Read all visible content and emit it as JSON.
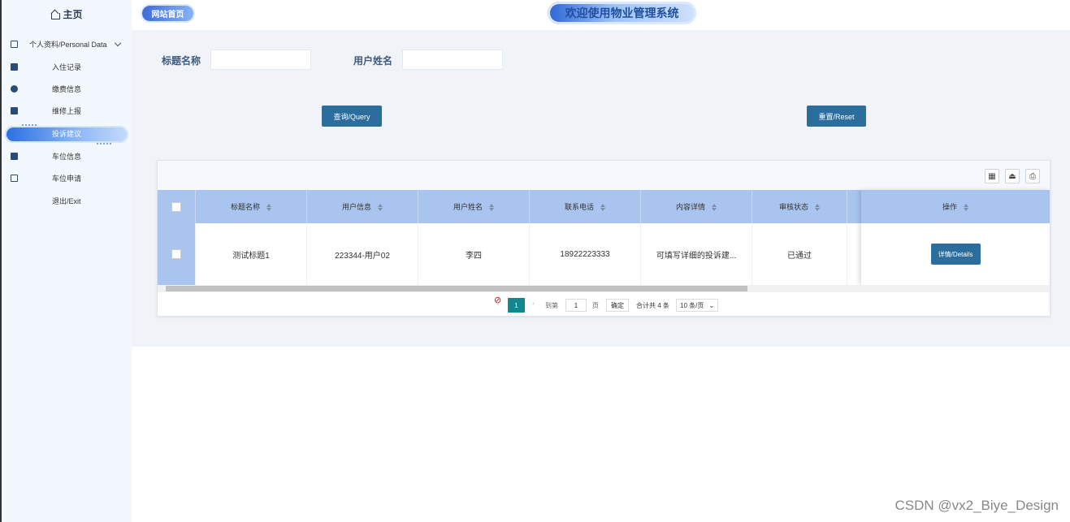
{
  "sidebar": {
    "home_label": "主页",
    "menu": [
      {
        "label": "个人资料/Personal Data"
      },
      {
        "label": "入住记录"
      },
      {
        "label": "缴费信息"
      },
      {
        "label": "维修上报"
      },
      {
        "label": "投诉建议"
      },
      {
        "label": "车位信息"
      },
      {
        "label": "车位申请"
      },
      {
        "label": "退出/Exit"
      }
    ]
  },
  "topbar": {
    "site_home": "网站首页",
    "title": "欢迎使用物业管理系统"
  },
  "search": {
    "title_label": "标题名称",
    "title_value": "",
    "user_label": "用户姓名",
    "user_value": "",
    "query_button": "查询/Query",
    "reset_button": "重置/Reset"
  },
  "table": {
    "columns": [
      "标题名称",
      "用户信息",
      "用户姓名",
      "联系电话",
      "内容详情",
      "审核状态",
      "操作"
    ],
    "rows": [
      {
        "title": "测试标题1",
        "user_info": "223344-用户02",
        "user_name": "李四",
        "phone": "18922223333",
        "content": "可填写详细的投诉建...",
        "status": "已通过",
        "action": "详情/Details"
      }
    ]
  },
  "pager": {
    "current": "1",
    "goto_label": "到第",
    "goto_value": "1",
    "page_unit": "页",
    "confirm": "确定",
    "total": "合计共 4 条",
    "page_size": "10 条/页"
  },
  "watermark": "CSDN @vx2_Biye_Design"
}
